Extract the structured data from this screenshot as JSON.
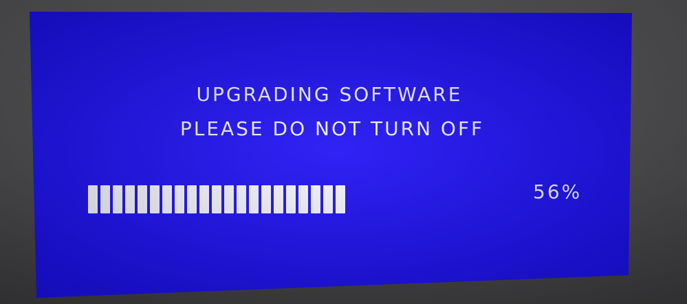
{
  "screen": {
    "line1": "UPGRADING SOFTWARE",
    "line2": "PLEASE DO NOT TURN OFF",
    "progress_percent_text": "56%",
    "progress_value": 0.56,
    "colors": {
      "screen_background": "#1a0ff0",
      "text": "#f2f2ff",
      "progress_fill": "#f6f6ff",
      "bezel": "#4e4e50"
    }
  }
}
